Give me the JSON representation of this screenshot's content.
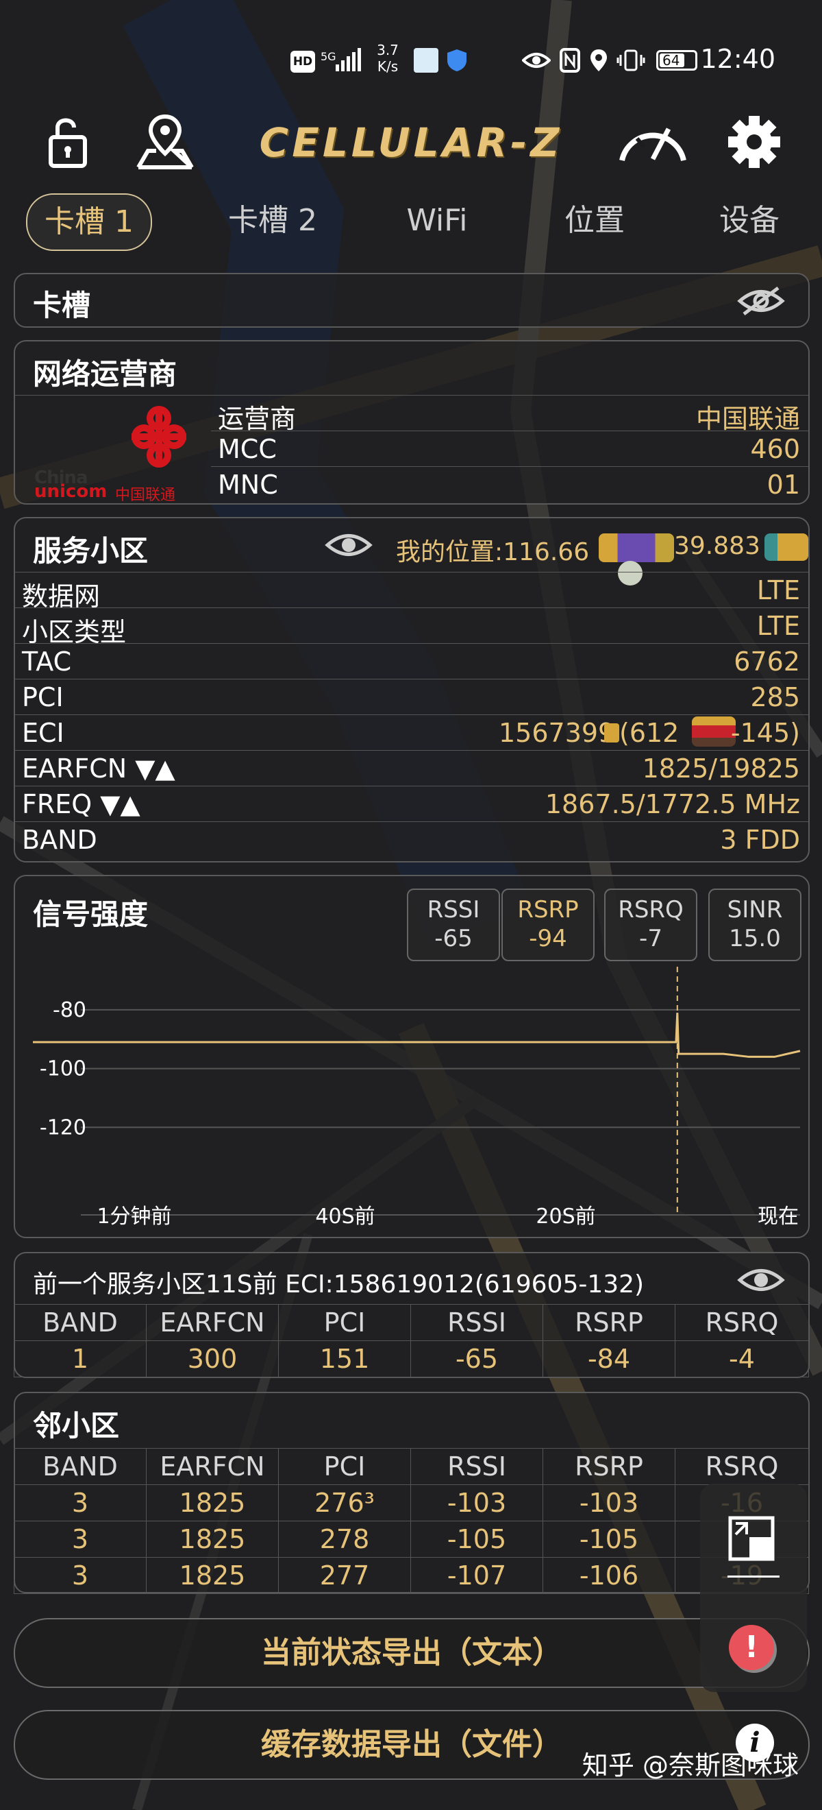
{
  "status_bar": {
    "hd": "HD",
    "net": "5G",
    "speed_value": "3.7",
    "speed_unit": "K/s",
    "battery": "64",
    "time": "12:40"
  },
  "header": {
    "app_title": "CELLULAR-Z"
  },
  "tabs": [
    {
      "label": "卡槽 1",
      "active": true
    },
    {
      "label": "卡槽 2",
      "active": false
    },
    {
      "label": "WiFi",
      "active": false
    },
    {
      "label": "位置",
      "active": false
    },
    {
      "label": "设备",
      "active": false
    }
  ],
  "slot_card": {
    "title": "卡槽"
  },
  "operator": {
    "title": "网络运营商",
    "logo_text_en_1": "China",
    "logo_text_en_2": "unicom",
    "logo_text_cn": "中国联通",
    "rows": [
      {
        "key": "运营商",
        "value": "中国联通"
      },
      {
        "key": "MCC",
        "value": "460"
      },
      {
        "key": "MNC",
        "value": "01"
      }
    ]
  },
  "serving_cell": {
    "title": "服务小区",
    "location": "我的位置:116.66",
    "location_tail": "39.883",
    "rows": [
      {
        "key": "数据网",
        "value": "LTE"
      },
      {
        "key": "小区类型",
        "value": "LTE"
      },
      {
        "key": "TAC",
        "value": "6762"
      },
      {
        "key": "PCI",
        "value": "285"
      },
      {
        "key": "ECI",
        "value": "1567399"
      },
      {
        "key": "EARFCN ▼▲",
        "value": "1825/19825"
      },
      {
        "key": "FREQ ▼▲",
        "value": "1867.5/1772.5 MHz"
      },
      {
        "key": "BAND",
        "value": "3 FDD"
      }
    ],
    "eci_mid": "(612",
    "eci_tail": "-145)"
  },
  "signal": {
    "title": "信号强度",
    "chips": [
      {
        "name": "RSSI",
        "value": "-65",
        "selected": false
      },
      {
        "name": "RSRP",
        "value": "-94",
        "selected": true
      },
      {
        "name": "RSRQ",
        "value": "-7",
        "selected": false
      },
      {
        "name": "SINR",
        "value": "15.0",
        "selected": false
      }
    ]
  },
  "chart_data": {
    "type": "line",
    "ylabel": "",
    "xlabel": "",
    "yticks": [
      "-80",
      "-100",
      "-120"
    ],
    "ylim": [
      -140,
      -70
    ],
    "x_ticks": [
      "1分钟前",
      "40S前",
      "20S前",
      "现在"
    ],
    "series": [
      {
        "color": "#e7c37a",
        "x": [
          -60,
          -55,
          -50,
          -45,
          -40,
          -35,
          -30,
          -25,
          -20,
          -15,
          -9.7,
          -9.6,
          -9.5,
          -6,
          -4,
          -2,
          -1,
          0
        ],
        "values": [
          -91,
          -91,
          -91,
          -91,
          -91,
          -91,
          -91,
          -91,
          -91,
          -91,
          -91,
          -81,
          -95,
          -95,
          -96,
          -96,
          -95,
          -94
        ]
      }
    ],
    "marker_x": -9.6,
    "grid": true
  },
  "previous_cell": {
    "title": "前一个服务小区11S前 ECI:158619012(619605-132)",
    "headers": [
      "BAND",
      "EARFCN",
      "PCI",
      "RSSI",
      "RSRP",
      "RSRQ"
    ],
    "rows": [
      [
        "1",
        "300",
        "151",
        "-65",
        "-84",
        "-4"
      ]
    ]
  },
  "neighbors": {
    "title": "邻小区",
    "headers": [
      "BAND",
      "EARFCN",
      "PCI",
      "RSSI",
      "RSRP",
      "RSRQ"
    ],
    "rows": [
      [
        "3",
        "1825",
        "276³",
        "-103",
        "-103",
        "-16"
      ],
      [
        "3",
        "1825",
        "278",
        "-105",
        "-105",
        ""
      ],
      [
        "3",
        "1825",
        "277",
        "-107",
        "-106",
        "-19"
      ]
    ]
  },
  "buttons": {
    "export_text": "当前状态导出（文本）",
    "export_file": "缓存数据导出（文件）"
  },
  "watermark": "知乎 @奈斯图咪球",
  "colors": {
    "accent": "#e7c37a",
    "background": "#1d1d1f",
    "border": "#5a5a5a",
    "alert": "#e8525a"
  }
}
